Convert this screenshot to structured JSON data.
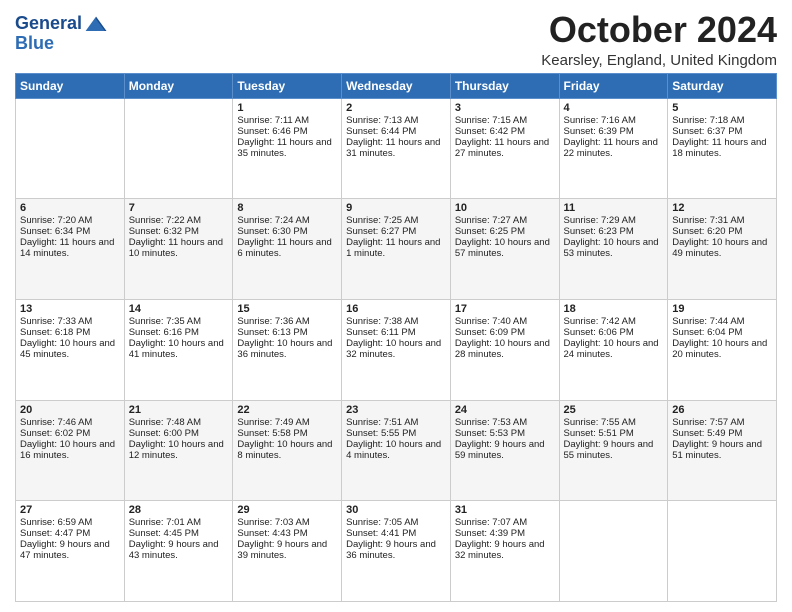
{
  "logo": {
    "line1": "General",
    "line2": "Blue"
  },
  "title": "October 2024",
  "subtitle": "Kearsley, England, United Kingdom",
  "days_of_week": [
    "Sunday",
    "Monday",
    "Tuesday",
    "Wednesday",
    "Thursday",
    "Friday",
    "Saturday"
  ],
  "weeks": [
    [
      {
        "day": "",
        "sunrise": "",
        "sunset": "",
        "daylight": ""
      },
      {
        "day": "",
        "sunrise": "",
        "sunset": "",
        "daylight": ""
      },
      {
        "day": "1",
        "sunrise": "Sunrise: 7:11 AM",
        "sunset": "Sunset: 6:46 PM",
        "daylight": "Daylight: 11 hours and 35 minutes."
      },
      {
        "day": "2",
        "sunrise": "Sunrise: 7:13 AM",
        "sunset": "Sunset: 6:44 PM",
        "daylight": "Daylight: 11 hours and 31 minutes."
      },
      {
        "day": "3",
        "sunrise": "Sunrise: 7:15 AM",
        "sunset": "Sunset: 6:42 PM",
        "daylight": "Daylight: 11 hours and 27 minutes."
      },
      {
        "day": "4",
        "sunrise": "Sunrise: 7:16 AM",
        "sunset": "Sunset: 6:39 PM",
        "daylight": "Daylight: 11 hours and 22 minutes."
      },
      {
        "day": "5",
        "sunrise": "Sunrise: 7:18 AM",
        "sunset": "Sunset: 6:37 PM",
        "daylight": "Daylight: 11 hours and 18 minutes."
      }
    ],
    [
      {
        "day": "6",
        "sunrise": "Sunrise: 7:20 AM",
        "sunset": "Sunset: 6:34 PM",
        "daylight": "Daylight: 11 hours and 14 minutes."
      },
      {
        "day": "7",
        "sunrise": "Sunrise: 7:22 AM",
        "sunset": "Sunset: 6:32 PM",
        "daylight": "Daylight: 11 hours and 10 minutes."
      },
      {
        "day": "8",
        "sunrise": "Sunrise: 7:24 AM",
        "sunset": "Sunset: 6:30 PM",
        "daylight": "Daylight: 11 hours and 6 minutes."
      },
      {
        "day": "9",
        "sunrise": "Sunrise: 7:25 AM",
        "sunset": "Sunset: 6:27 PM",
        "daylight": "Daylight: 11 hours and 1 minute."
      },
      {
        "day": "10",
        "sunrise": "Sunrise: 7:27 AM",
        "sunset": "Sunset: 6:25 PM",
        "daylight": "Daylight: 10 hours and 57 minutes."
      },
      {
        "day": "11",
        "sunrise": "Sunrise: 7:29 AM",
        "sunset": "Sunset: 6:23 PM",
        "daylight": "Daylight: 10 hours and 53 minutes."
      },
      {
        "day": "12",
        "sunrise": "Sunrise: 7:31 AM",
        "sunset": "Sunset: 6:20 PM",
        "daylight": "Daylight: 10 hours and 49 minutes."
      }
    ],
    [
      {
        "day": "13",
        "sunrise": "Sunrise: 7:33 AM",
        "sunset": "Sunset: 6:18 PM",
        "daylight": "Daylight: 10 hours and 45 minutes."
      },
      {
        "day": "14",
        "sunrise": "Sunrise: 7:35 AM",
        "sunset": "Sunset: 6:16 PM",
        "daylight": "Daylight: 10 hours and 41 minutes."
      },
      {
        "day": "15",
        "sunrise": "Sunrise: 7:36 AM",
        "sunset": "Sunset: 6:13 PM",
        "daylight": "Daylight: 10 hours and 36 minutes."
      },
      {
        "day": "16",
        "sunrise": "Sunrise: 7:38 AM",
        "sunset": "Sunset: 6:11 PM",
        "daylight": "Daylight: 10 hours and 32 minutes."
      },
      {
        "day": "17",
        "sunrise": "Sunrise: 7:40 AM",
        "sunset": "Sunset: 6:09 PM",
        "daylight": "Daylight: 10 hours and 28 minutes."
      },
      {
        "day": "18",
        "sunrise": "Sunrise: 7:42 AM",
        "sunset": "Sunset: 6:06 PM",
        "daylight": "Daylight: 10 hours and 24 minutes."
      },
      {
        "day": "19",
        "sunrise": "Sunrise: 7:44 AM",
        "sunset": "Sunset: 6:04 PM",
        "daylight": "Daylight: 10 hours and 20 minutes."
      }
    ],
    [
      {
        "day": "20",
        "sunrise": "Sunrise: 7:46 AM",
        "sunset": "Sunset: 6:02 PM",
        "daylight": "Daylight: 10 hours and 16 minutes."
      },
      {
        "day": "21",
        "sunrise": "Sunrise: 7:48 AM",
        "sunset": "Sunset: 6:00 PM",
        "daylight": "Daylight: 10 hours and 12 minutes."
      },
      {
        "day": "22",
        "sunrise": "Sunrise: 7:49 AM",
        "sunset": "Sunset: 5:58 PM",
        "daylight": "Daylight: 10 hours and 8 minutes."
      },
      {
        "day": "23",
        "sunrise": "Sunrise: 7:51 AM",
        "sunset": "Sunset: 5:55 PM",
        "daylight": "Daylight: 10 hours and 4 minutes."
      },
      {
        "day": "24",
        "sunrise": "Sunrise: 7:53 AM",
        "sunset": "Sunset: 5:53 PM",
        "daylight": "Daylight: 9 hours and 59 minutes."
      },
      {
        "day": "25",
        "sunrise": "Sunrise: 7:55 AM",
        "sunset": "Sunset: 5:51 PM",
        "daylight": "Daylight: 9 hours and 55 minutes."
      },
      {
        "day": "26",
        "sunrise": "Sunrise: 7:57 AM",
        "sunset": "Sunset: 5:49 PM",
        "daylight": "Daylight: 9 hours and 51 minutes."
      }
    ],
    [
      {
        "day": "27",
        "sunrise": "Sunrise: 6:59 AM",
        "sunset": "Sunset: 4:47 PM",
        "daylight": "Daylight: 9 hours and 47 minutes."
      },
      {
        "day": "28",
        "sunrise": "Sunrise: 7:01 AM",
        "sunset": "Sunset: 4:45 PM",
        "daylight": "Daylight: 9 hours and 43 minutes."
      },
      {
        "day": "29",
        "sunrise": "Sunrise: 7:03 AM",
        "sunset": "Sunset: 4:43 PM",
        "daylight": "Daylight: 9 hours and 39 minutes."
      },
      {
        "day": "30",
        "sunrise": "Sunrise: 7:05 AM",
        "sunset": "Sunset: 4:41 PM",
        "daylight": "Daylight: 9 hours and 36 minutes."
      },
      {
        "day": "31",
        "sunrise": "Sunrise: 7:07 AM",
        "sunset": "Sunset: 4:39 PM",
        "daylight": "Daylight: 9 hours and 32 minutes."
      },
      {
        "day": "",
        "sunrise": "",
        "sunset": "",
        "daylight": ""
      },
      {
        "day": "",
        "sunrise": "",
        "sunset": "",
        "daylight": ""
      }
    ]
  ]
}
